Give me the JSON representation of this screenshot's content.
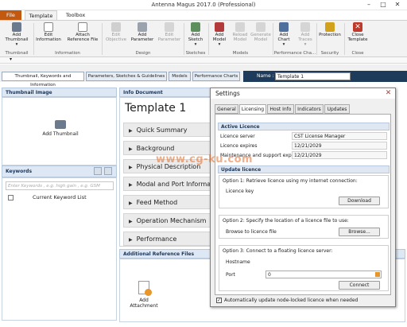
{
  "window": {
    "title": "Antenna Magus 2017.0 (Professional)"
  },
  "menu_tabs": {
    "file": "File",
    "template": "Template",
    "toolbox": "Toolbox"
  },
  "ribbon": {
    "buttons": [
      {
        "label": "Add Thumbnail",
        "caret": "▾"
      },
      {
        "label": "Edit Information"
      },
      {
        "label": "Attach Reference File"
      },
      {
        "label": "Edit Objective"
      },
      {
        "label": "Add Parameter"
      },
      {
        "label": "Edit Parameter"
      },
      {
        "label": "Add Sketch",
        "caret": "▾"
      },
      {
        "label": "Add Model",
        "caret": "▾"
      },
      {
        "label": "Reload Model"
      },
      {
        "label": "Generate Model"
      },
      {
        "label": "Add Chart",
        "caret": "▾"
      },
      {
        "label": "Add Traces",
        "caret": "▾"
      },
      {
        "label": "Protection"
      },
      {
        "label": "Close Template"
      }
    ],
    "groups": [
      "Thumbnail",
      "Information",
      "Design",
      "Sketches",
      "Models",
      "Performance Cha...",
      "Security",
      "Close"
    ]
  },
  "doc_tabs": [
    "Thumbnail, Keywords and Information",
    "Parameters, Sketches & Guidelines",
    "Models",
    "Performance Charts"
  ],
  "name_field": {
    "label": "Name :",
    "value": "Template 1"
  },
  "thumbnail_panel": {
    "header": "Thumbnail Image",
    "add_label": "Add Thumbnail",
    "caret": "▾"
  },
  "keywords_panel": {
    "header": "Keywords",
    "placeholder": "Enter Keywords , e.g. high gain , e.g. GSM",
    "list_label": "Current Keyword List"
  },
  "info_panel": {
    "header": "Info Document",
    "doc_title": "Template 1",
    "sections": [
      "Quick Summary",
      "Background",
      "Physical Description",
      "Modal and Port Information",
      "Feed Method",
      "Operation Mechanism",
      "Performance"
    ]
  },
  "additional_panel": {
    "header": "Additional Reference Files",
    "add_label": "Add Attachment"
  },
  "settings": {
    "title": "Settings",
    "tabs": [
      "General",
      "Licensing",
      "Host Info",
      "Indicators",
      "Updates"
    ],
    "active_licence": {
      "header": "Active Licence",
      "rows": [
        {
          "key": "Licence server",
          "value": "CST License Manager"
        },
        {
          "key": "Licence expires",
          "value": "12/21/2029"
        },
        {
          "key": "Maintenance and support expires",
          "value": "12/21/2029"
        }
      ]
    },
    "update": {
      "header": "Update licence",
      "option1": {
        "title": "Option 1: Retrieve licence using my internet connection:",
        "field_label": "Licence key",
        "button": "Download"
      },
      "option2": {
        "title": "Option 2: Specify the location of a licence file to use:",
        "field_label": "Browse to licence file",
        "button": "Browse..."
      },
      "option3": {
        "title": "Option 3: Connect to a floating licence server:",
        "host_label": "Hostname",
        "port_label": "Port",
        "port_value": "0",
        "button": "Connect"
      }
    },
    "auto_update": "Automatically update node-locked licence when needed"
  },
  "watermark": "www.cg-ku.com",
  "colors": {
    "file_tab": "#c2590f",
    "name_bar": "#1f3b5b",
    "panel_header": "#dde8f4"
  }
}
